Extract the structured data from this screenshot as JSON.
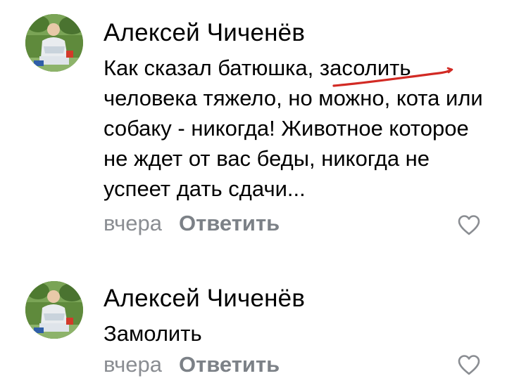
{
  "comments": [
    {
      "author": "Алексей Чиченёв",
      "text": "Как сказал батюшка, засолить человека тяжело, но можно, кота или собаку - никогда! Животное которое не ждет от вас беды, никогда не успеет дать сдачи...",
      "time": "вчера",
      "reply_label": "Ответить",
      "like_icon": "heart-outline-icon"
    },
    {
      "author": "Алексей Чиченёв",
      "text": "Замолить",
      "time": "вчера",
      "reply_label": "Ответить",
      "like_icon": "heart-outline-icon"
    }
  ],
  "colors": {
    "meta_text": "#8a8d92",
    "reply_text": "#7c8187",
    "icon": "#8a8d92",
    "annotation": "#d22a24"
  }
}
